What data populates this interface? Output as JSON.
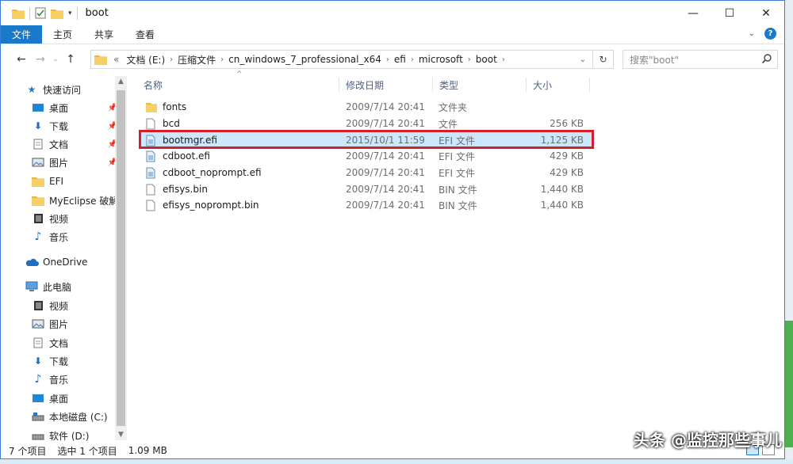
{
  "window": {
    "title": "boot",
    "controls": {
      "minimize": "—",
      "maximize": "☐",
      "close": "✕"
    }
  },
  "ribbon": {
    "tabs": [
      "文件",
      "主页",
      "共享",
      "查看"
    ]
  },
  "address": {
    "crumbs": [
      "文档 (E:)",
      "压缩文件",
      "cn_windows_7_professional_x64",
      "efi",
      "microsoft",
      "boot"
    ],
    "overflow": "«"
  },
  "search": {
    "placeholder": "搜索\"boot\""
  },
  "nav_pane": {
    "quick_access": "快速访问",
    "items": [
      {
        "label": "快速访问",
        "icon": "star-icon",
        "top": 0
      },
      {
        "label": "桌面",
        "icon": "desktop-icon",
        "pinned": true
      },
      {
        "label": "下载",
        "icon": "download-icon",
        "pinned": true
      },
      {
        "label": "文档",
        "icon": "document-icon",
        "pinned": true
      },
      {
        "label": "图片",
        "icon": "picture-icon",
        "pinned": true
      },
      {
        "label": "EFI",
        "icon": "folder-icon"
      },
      {
        "label": "MyEclipse 破解",
        "icon": "folder-icon"
      },
      {
        "label": "视频",
        "icon": "video-icon"
      },
      {
        "label": "音乐",
        "icon": "music-icon"
      },
      {
        "label": "OneDrive",
        "icon": "cloud-icon"
      },
      {
        "label": "此电脑",
        "icon": "computer-icon"
      },
      {
        "label": "视频",
        "icon": "video-icon"
      },
      {
        "label": "图片",
        "icon": "picture-icon"
      },
      {
        "label": "文档",
        "icon": "document-icon"
      },
      {
        "label": "下载",
        "icon": "download-icon"
      },
      {
        "label": "音乐",
        "icon": "music-icon"
      },
      {
        "label": "桌面",
        "icon": "desktop-icon"
      },
      {
        "label": "本地磁盘 (C:)",
        "icon": "drive-icon"
      },
      {
        "label": "软件 (D:)",
        "icon": "drive-icon"
      }
    ]
  },
  "columns": {
    "name": "名称",
    "date": "修改日期",
    "type": "类型",
    "size": "大小"
  },
  "files": [
    {
      "name": "fonts",
      "date": "2009/7/14 20:41",
      "type": "文件夹",
      "size": "",
      "icon": "folder-icon"
    },
    {
      "name": "bcd",
      "date": "2009/7/14 20:41",
      "type": "文件",
      "size": "256 KB",
      "icon": "file-icon"
    },
    {
      "name": "bootmgr.efi",
      "date": "2015/10/1 11:59",
      "type": "EFI 文件",
      "size": "1,125 KB",
      "icon": "efi-file-icon",
      "selected": true
    },
    {
      "name": "cdboot.efi",
      "date": "2009/7/14 20:41",
      "type": "EFI 文件",
      "size": "429 KB",
      "icon": "efi-file-icon"
    },
    {
      "name": "cdboot_noprompt.efi",
      "date": "2009/7/14 20:41",
      "type": "EFI 文件",
      "size": "429 KB",
      "icon": "efi-file-icon"
    },
    {
      "name": "efisys.bin",
      "date": "2009/7/14 20:41",
      "type": "BIN 文件",
      "size": "1,440 KB",
      "icon": "file-icon"
    },
    {
      "name": "efisys_noprompt.bin",
      "date": "2009/7/14 20:41",
      "type": "BIN 文件",
      "size": "1,440 KB",
      "icon": "file-icon"
    }
  ],
  "status": {
    "count": "7 个项目",
    "selected": "选中 1 个项目",
    "size": "1.09 MB"
  },
  "watermark": "头条 @监控那些事儿",
  "colors": {
    "accent": "#1979ca",
    "highlight_border": "#d21f2b",
    "selection": "#cce8ff"
  }
}
